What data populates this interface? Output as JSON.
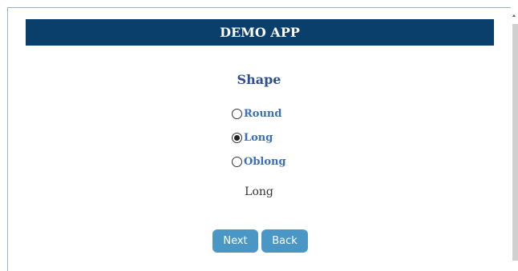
{
  "header": {
    "title": "DEMO APP"
  },
  "form": {
    "title": "Shape",
    "options": [
      {
        "label": "Round",
        "checked": false
      },
      {
        "label": "Long",
        "checked": true
      },
      {
        "label": "Oblong",
        "checked": false
      }
    ],
    "selected_value": "Long"
  },
  "buttons": {
    "next_label": "Next",
    "back_label": "Back"
  },
  "colors": {
    "header_bg": "#0b3f6b",
    "title": "#2d4f8f",
    "option_label": "#3a6fb5",
    "button_bg": "#4a97c6"
  }
}
